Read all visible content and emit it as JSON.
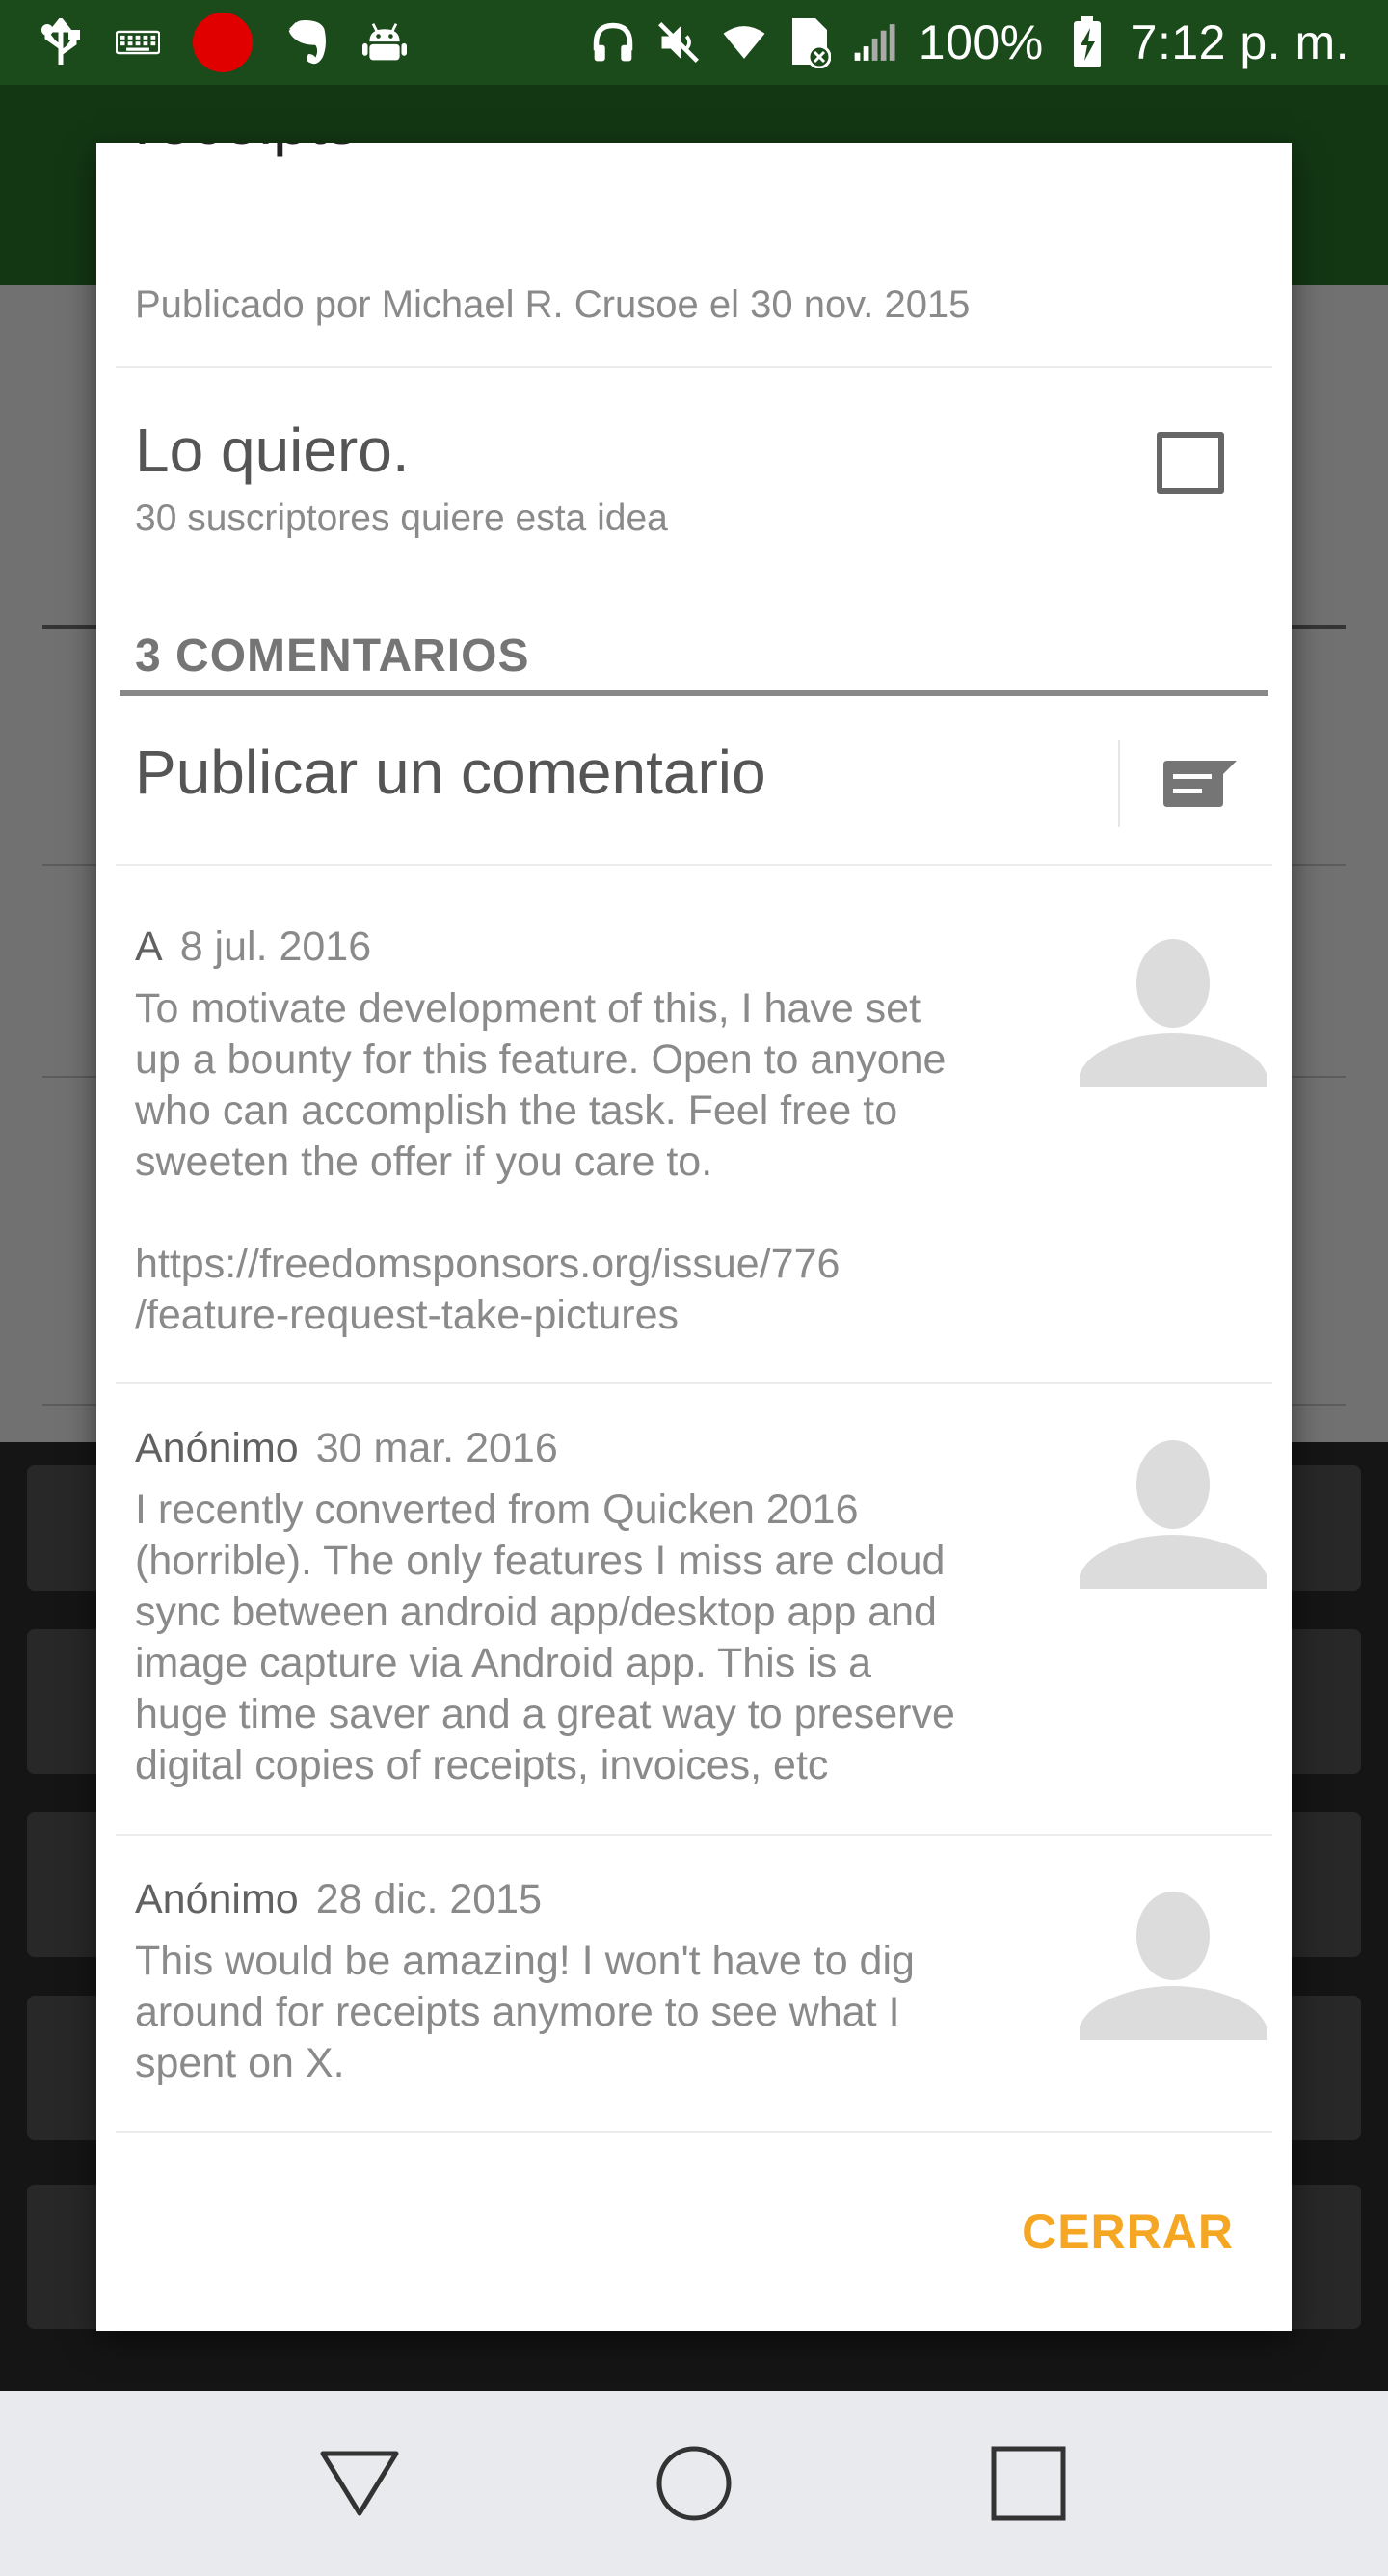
{
  "status_bar": {
    "battery": "100%",
    "time": "7:12 p. m.",
    "icons": [
      "usb-icon",
      "keyboard-icon",
      "record-icon",
      "evernote-icon",
      "android-icon",
      "headphones-icon",
      "mute-icon",
      "wifi-icon",
      "sim-icon",
      "signal-icon",
      "battery-charging-icon"
    ]
  },
  "dialog": {
    "title_partial": "receipts",
    "published": "Publicado por Michael R. Crusoe el 30 nov. 2015",
    "want": {
      "title": "Lo quiero.",
      "subtitle": "30 suscriptores quiere esta idea",
      "checked": false
    },
    "comments_header": "3 COMENTARIOS",
    "post_comment_label": "Publicar un comentario",
    "comments": [
      {
        "author": "A",
        "date": "8 jul. 2016",
        "body": "To motivate development of this, I have set\nup a bounty for this feature. Open to anyone\nwho can accomplish the task. Feel free to\nsweeten the offer if you care to.\n\nhttps://freedomsponsors.org/issue/776\n/feature-request-take-pictures"
      },
      {
        "author": "Anónimo",
        "date": "30 mar. 2016",
        "body": "I recently converted from Quicken 2016\n(horrible). The only features I miss are cloud\nsync between android app/desktop app and\nimage capture via Android app. This is a\nhuge time saver and a great way to preserve\ndigital copies of receipts, invoices, etc"
      },
      {
        "author": "Anónimo",
        "date": "28 dic. 2015",
        "body": "This would be amazing! I won't have to dig\naround for receipts anymore to see what I\nspent on X."
      }
    ],
    "close_label": "CERRAR"
  },
  "colors": {
    "app_bar": "#2b7a2b",
    "status_bar": "#1b4a1b",
    "accent": "#f5a623"
  }
}
